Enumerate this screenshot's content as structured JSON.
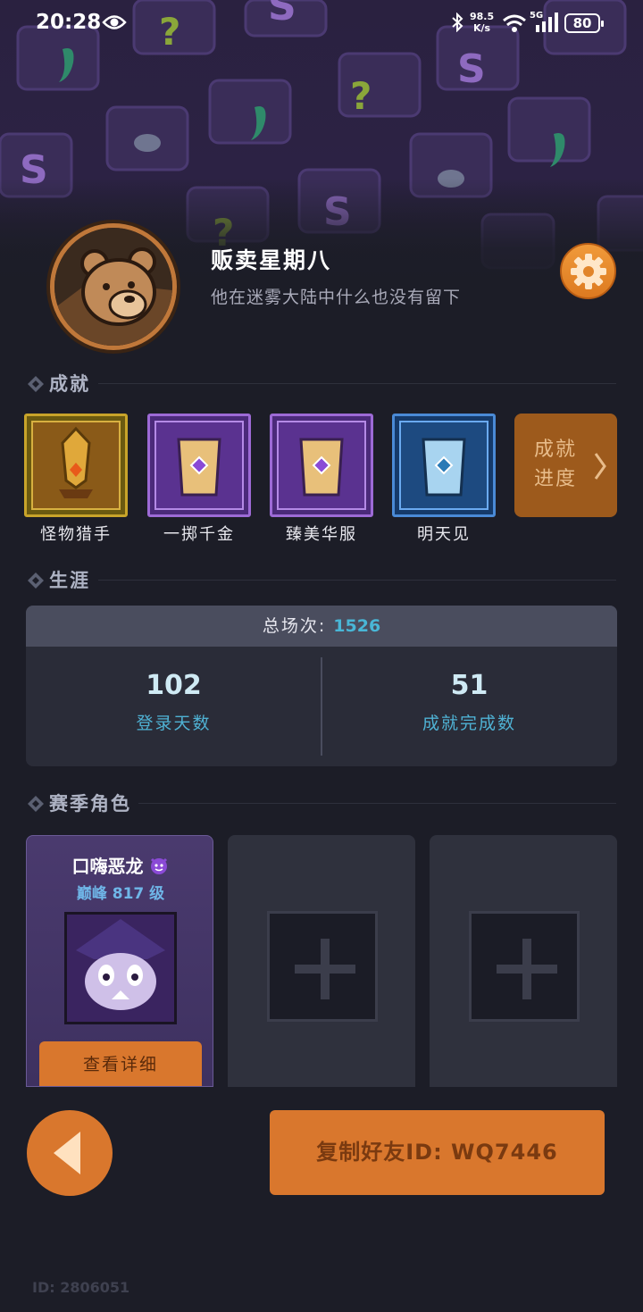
{
  "status_bar": {
    "time": "20:28",
    "speed_value": "98.5",
    "speed_unit": "K/s",
    "network": "5G",
    "battery": "80"
  },
  "profile": {
    "name": "贩卖星期八",
    "bio": "他在迷雾大陆中什么也没有留下",
    "avatar_icon": "bear-avatar-icon",
    "settings_icon": "gear-icon"
  },
  "achievements": {
    "title": "成就",
    "items": [
      {
        "label": "怪物猎手",
        "tier": "gold"
      },
      {
        "label": "一掷千金",
        "tier": "purple"
      },
      {
        "label": "臻美华服",
        "tier": "purple"
      },
      {
        "label": "明天见",
        "tier": "blue"
      }
    ],
    "progress_label": "成就进度"
  },
  "career": {
    "title": "生涯",
    "total_label": "总场次:",
    "total_value": "1526",
    "login_days_value": "102",
    "login_days_label": "登录天数",
    "achievements_done_value": "51",
    "achievements_done_label": "成就完成数"
  },
  "season_roles": {
    "title": "赛季角色",
    "role": {
      "name": "口嗨恶龙",
      "level": "巅峰 817 级",
      "detail_label": "查看详细"
    }
  },
  "bottom": {
    "copy_label": "复制好友ID: WQ7446",
    "uid": "ID: 2806051"
  },
  "colors": {
    "accent_orange": "#d9772d",
    "career_blue": "#49b6d6",
    "background": "#1c1d27"
  }
}
